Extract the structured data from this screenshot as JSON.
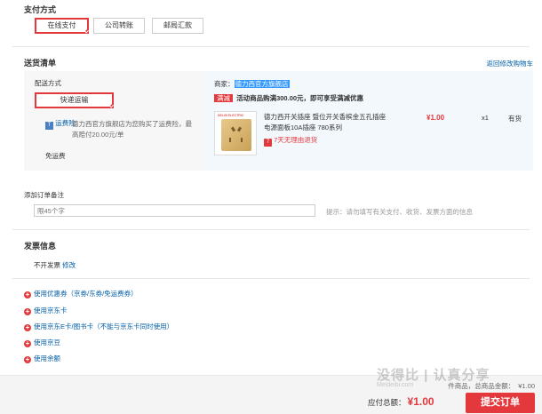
{
  "payment": {
    "title": "支付方式",
    "options": [
      "在线支付",
      "公司转账",
      "邮局汇款"
    ]
  },
  "delivery": {
    "title": "送货清单",
    "back_link": "返回修改购物车",
    "method_title": "配送方式",
    "method_btn": "快递运输",
    "insurance_badge": "运费险",
    "insurance_text": "德力西官方旗舰店为您购买了运费险，最高赔付20.00元/单",
    "free_shipping": "免运费",
    "seller_label": "商家：",
    "seller_name": "德力西官方旗舰店",
    "promo_badge": "满减",
    "promo_text": "活动商品购满300.00元，即可享受满减优惠",
    "product": {
      "thumb_logo": "DELIXI ELECTRIC",
      "name": "德力西开关插座 暨位开关香槟金五孔插座电源面板10A插座 780系列",
      "return_badge": "7",
      "return_text": "7天无理由退货",
      "price": "¥1.00",
      "qty": "x1",
      "stock": "有货"
    }
  },
  "remark": {
    "label": "添加订单备注",
    "placeholder": "限45个字",
    "hint": "提示：请勿填写有关支付、收货、发票方面的信息"
  },
  "invoice": {
    "title": "发票信息",
    "value": "不开发票",
    "edit_link": "修改"
  },
  "extras": [
    "使用优惠券（京券/东券/免运费券）",
    "使用京东卡",
    "使用京东E卡/图书卡（不能与京东卡同时使用）",
    "使用京豆",
    "使用余额"
  ],
  "summary": {
    "items_label": "件商品，总商品金额：",
    "items_value": "¥1.00",
    "total_label": "应付总额：",
    "total_value": "¥1.00",
    "submit": "提交订单"
  },
  "watermark": {
    "line1": "没得比 | 认真分享",
    "line2": "Meideibi.com"
  },
  "colors": {
    "accent": "#e4393c",
    "link": "#005ea7",
    "panel": "#f3f8fd"
  }
}
